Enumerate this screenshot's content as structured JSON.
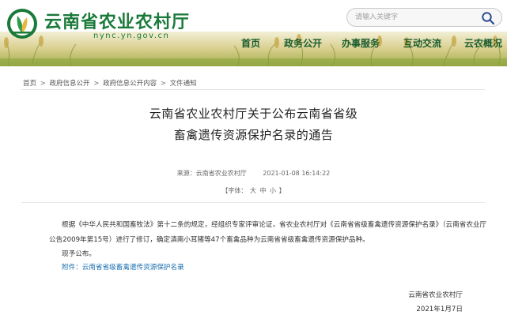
{
  "header": {
    "site_title": "云南省农业农村厅",
    "site_url": "nync.yn.gov.cn",
    "logo_icon": "wheat-leaf-logo",
    "search": {
      "placeholder": "请输入关键字",
      "icon": "search-icon"
    },
    "nav": [
      "首页",
      "政务公开",
      "办事服务",
      "互动交流",
      "云农概况"
    ]
  },
  "breadcrumb": [
    "首页",
    "政府信息公开",
    "政府信息公开内容",
    "文件通知"
  ],
  "breadcrumb_sep": ">",
  "article": {
    "title_line1": "云南省农业农村厅关于公布云南省省级",
    "title_line2": "畜禽遗传资源保护名录的通告",
    "source": "来源：云南省农业农村厅",
    "date": "2021-01-08 16:14:22",
    "font_label": "【字体：",
    "font_sizes": [
      "大",
      "中",
      "小"
    ],
    "font_close": "】",
    "paragraph1": "根据《中华人民共和国畜牧法》第十二条的规定，经组织专家评审论证，省农业农村厅对《云南省省级畜禽遗传资源保护名录》（云南省农业厅公告2009年第15号）进行了修订，确定滇南小耳猪等47个畜禽品种为云南省省级畜禽遗传资源保护品种。",
    "paragraph2": "现予公布。",
    "attachment_label": "附件：",
    "attachment_link": "云南省省级畜禽遗传资源保护名录",
    "signature": "云南省农业农村厅",
    "sign_date": "2021年1月7日"
  },
  "colors": {
    "brand_green": "#1a7a3a",
    "nav_green": "#1a5c2e",
    "link_blue": "#1a6fb0",
    "search_icon": "#2a4d8f"
  }
}
